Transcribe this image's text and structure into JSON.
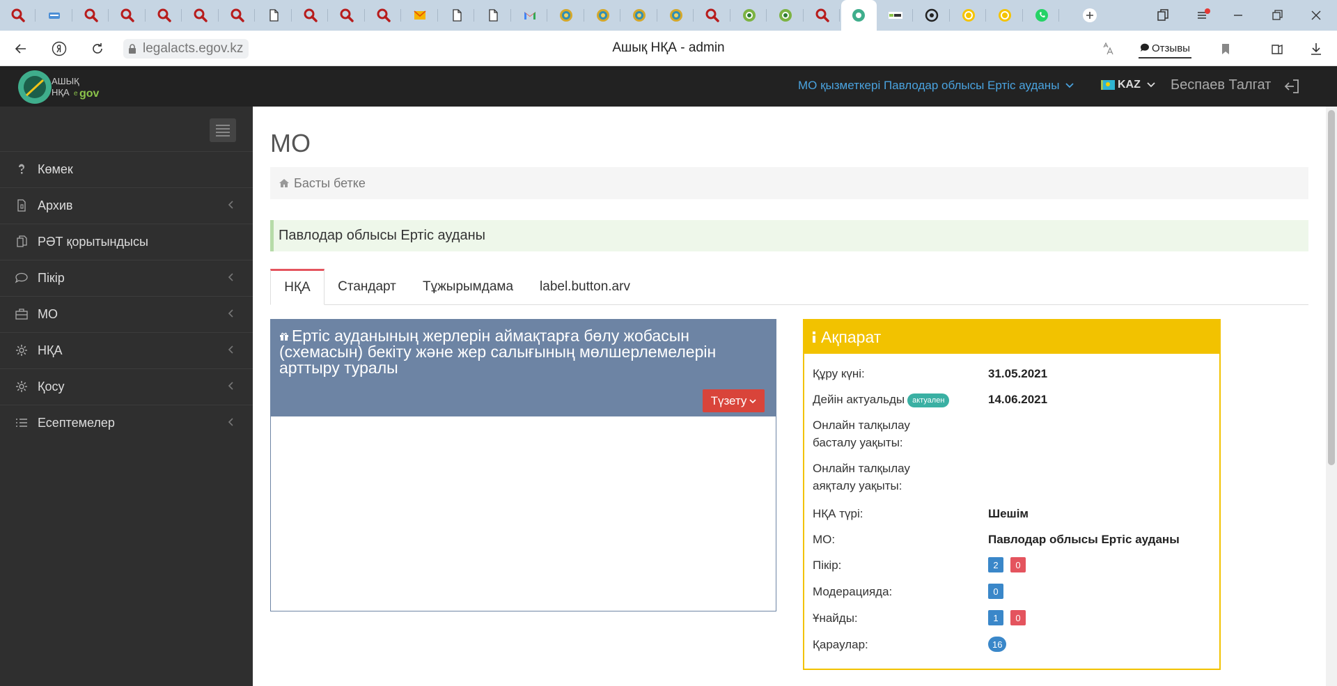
{
  "browser": {
    "url": "legalacts.egov.kz",
    "title": "Ашық НҚА - admin",
    "feedback_label": "Отзывы"
  },
  "header": {
    "org_menu": "МО қызметкері Павлодар облысы Ертіс ауданы",
    "language": "KAZ",
    "user_name": "Беспаев Талгат",
    "logo_text": [
      "АШЫҚ",
      "НҚА",
      "e",
      "gov"
    ]
  },
  "sidebar": {
    "items": [
      {
        "label": "Көмек",
        "icon": "question-icon",
        "has_children": false
      },
      {
        "label": "Архив",
        "icon": "archive-icon",
        "has_children": true
      },
      {
        "label": "РӘТ қорытындысы",
        "icon": "copy-icon",
        "has_children": false
      },
      {
        "label": "Пікір",
        "icon": "comment-icon",
        "has_children": true
      },
      {
        "label": "МО",
        "icon": "briefcase-icon",
        "has_children": true
      },
      {
        "label": "НҚА",
        "icon": "gear-icon",
        "has_children": true
      },
      {
        "label": "Қосу",
        "icon": "gear-icon",
        "has_children": true
      },
      {
        "label": "Есептемелер",
        "icon": "list-icon",
        "has_children": true
      }
    ]
  },
  "main": {
    "heading": "МО",
    "breadcrumb": "Басты бетке",
    "region": "Павлодар облысы Ертіс ауданы",
    "tabs": [
      {
        "label": "НҚА",
        "active": true
      },
      {
        "label": "Стандарт",
        "active": false
      },
      {
        "label": "Тұжырымдама",
        "active": false
      },
      {
        "label": "label.button.arv",
        "active": false
      }
    ],
    "document": {
      "title": "Ертіс ауданының жерлерін аймақтарға бөлу жобасын (схемасын) бекіту және жер салығының мөлшерлемелерін арттыру туралы",
      "edit_label": "Түзету"
    },
    "info": {
      "title": "Ақпарат",
      "created_label": "Құру күні:",
      "created_value": "31.05.2021",
      "actual_label": "Дейін актуальды",
      "actual_badge": "актуален",
      "actual_value": "14.06.2021",
      "online_start_label_1": "Онлайн талқылау",
      "online_start_label_2": "басталу уақыты:",
      "online_end_label_1": "Онлайн талқылау",
      "online_end_label_2": "аяқталу уақыты:",
      "type_label": "НҚА түрі:",
      "type_value": "Шешім",
      "mo_label": "МО:",
      "mo_value": "Павлодар облысы Ертіс ауданы",
      "comments_label": "Пікір:",
      "comments_positive": "2",
      "comments_negative": "0",
      "moderation_label": "Модерацияда:",
      "moderation_count": "0",
      "likes_label": "Ұнайды:",
      "likes_positive": "1",
      "likes_negative": "0",
      "views_label": "Қараулар:",
      "views_count": "16"
    }
  },
  "colors": {
    "header_bg": "#222222",
    "sidebar_bg": "#2f2f2f",
    "doc_panel": "#6d84a4",
    "info_panel": "#f2c200",
    "edit_button": "#d9443a",
    "link": "#4aa3df"
  }
}
